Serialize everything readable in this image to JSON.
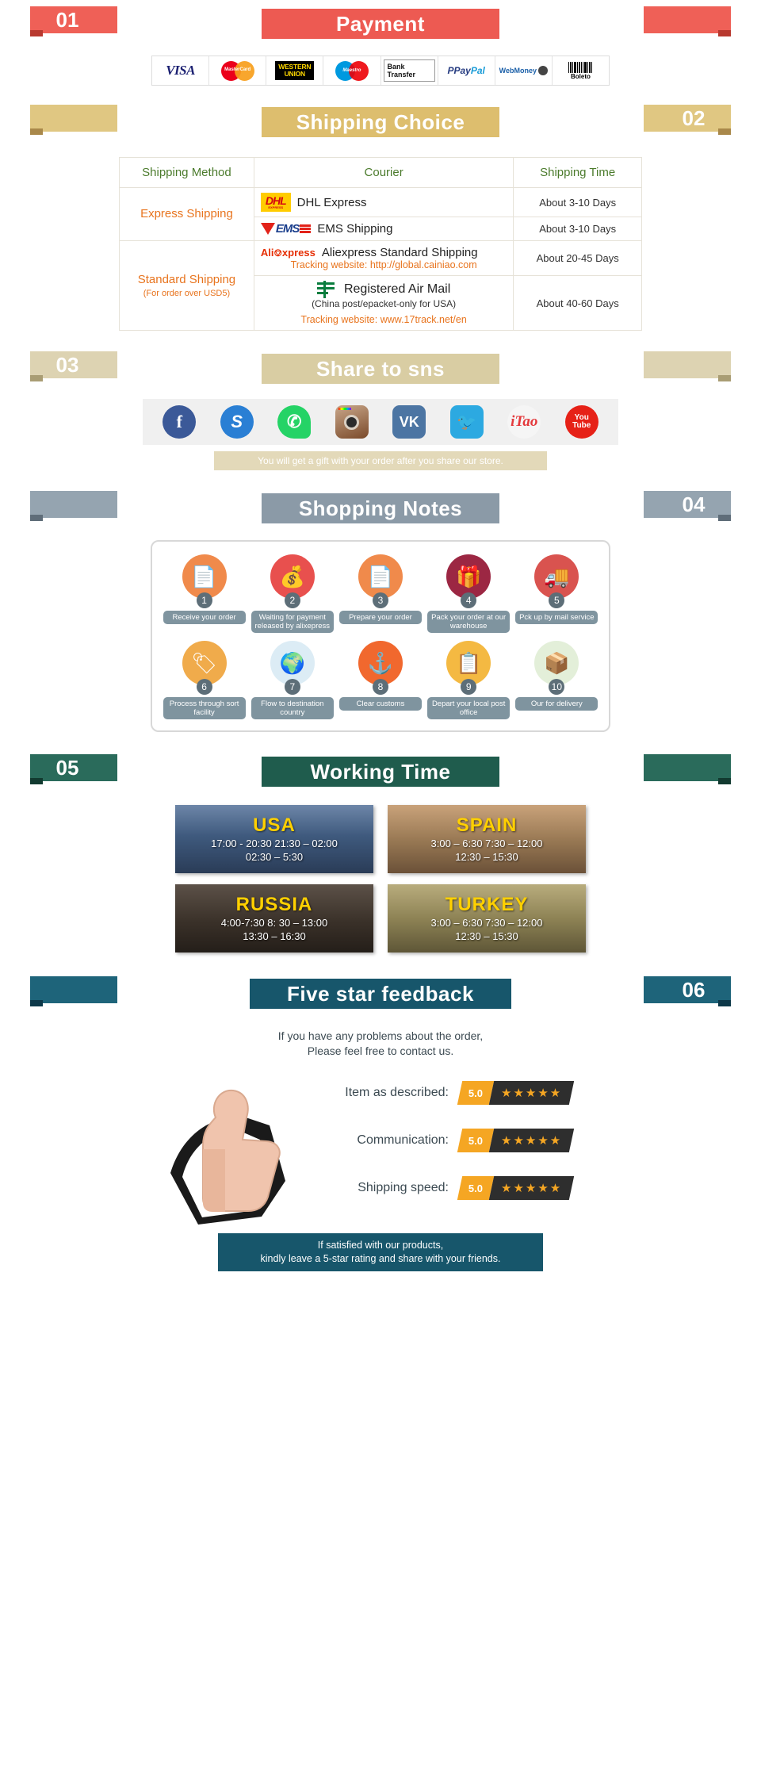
{
  "sections": {
    "payment": {
      "number": "01",
      "title": "Payment"
    },
    "shipping": {
      "number": "02",
      "title": "Shipping Choice"
    },
    "share": {
      "number": "03",
      "title": "Share to sns"
    },
    "notes": {
      "number": "04",
      "title": "Shopping Notes"
    },
    "working": {
      "number": "05",
      "title": "Working Time"
    },
    "feedback": {
      "number": "06",
      "title": "Five star feedback"
    }
  },
  "payment_methods": [
    {
      "name": "visa-logo",
      "label": "VISA"
    },
    {
      "name": "mastercard-logo",
      "label": "MasterCard"
    },
    {
      "name": "western-union-logo",
      "label": "WESTERN UNION"
    },
    {
      "name": "maestro-logo",
      "label": "Maestro"
    },
    {
      "name": "bank-transfer-logo",
      "label": "Bank Transfer"
    },
    {
      "name": "paypal-logo",
      "label": "PayPal"
    },
    {
      "name": "webmoney-logo",
      "label": "WebMoney"
    },
    {
      "name": "boleto-logo",
      "label": "Boleto"
    }
  ],
  "shipping_table": {
    "headers": [
      "Shipping Method",
      "Courier",
      "Shipping Time"
    ],
    "rows": [
      {
        "method": "Express Shipping",
        "method_sub": "",
        "couriers": [
          {
            "logo": "dhl-logo",
            "name": "DHL Express",
            "time": "About 3-10 Days",
            "tracking": ""
          },
          {
            "logo": "ems-logo",
            "name": "EMS Shipping",
            "time": "About 3-10 Days",
            "tracking": ""
          }
        ]
      },
      {
        "method": "Standard Shipping",
        "method_sub": "(For order over USD5)",
        "couriers": [
          {
            "logo": "aliexpress-logo",
            "name": "Aliexpress Standard Shipping",
            "time": "About 20-45 Days",
            "tracking": "Tracking website: http://global.cainiao.com"
          },
          {
            "logo": "china-post-logo",
            "name": "Registered Air Mail",
            "name_sub": "(China post/epacket-only for USA)",
            "time": "About 40-60 Days",
            "tracking": "Tracking website: www.17track.net/en"
          }
        ]
      }
    ]
  },
  "social": {
    "icons": [
      {
        "name": "facebook-icon",
        "glyph": "f"
      },
      {
        "name": "skype-icon",
        "glyph": "S"
      },
      {
        "name": "whatsapp-icon",
        "glyph": "✆"
      },
      {
        "name": "instagram-icon",
        "glyph": ""
      },
      {
        "name": "vk-icon",
        "glyph": "VK"
      },
      {
        "name": "twitter-icon",
        "glyph": "🐦"
      },
      {
        "name": "itao-icon",
        "glyph": "iTao"
      },
      {
        "name": "youtube-icon",
        "glyph": "You Tube"
      }
    ],
    "gift_note": "You will get a gift with your order after you share our store."
  },
  "shopping_notes": [
    {
      "num": "1",
      "label": "Receive\nyour order",
      "icon": "invoice-icon",
      "color": "#f08a4b"
    },
    {
      "num": "2",
      "label": "Waiting for payment\nreleased by alixepress",
      "icon": "money-bag-icon",
      "color": "#e8504e"
    },
    {
      "num": "3",
      "label": "Prepare\nyour order",
      "icon": "invoice-icon",
      "color": "#f08a4b"
    },
    {
      "num": "4",
      "label": "Pack your order\nat our warehouse",
      "icon": "gift-box-icon",
      "color": "#9c2743"
    },
    {
      "num": "5",
      "label": "Pck up by\nmail service",
      "icon": "mail-truck-icon",
      "color": "#d9534f"
    },
    {
      "num": "6",
      "label": "Process through\nsort facility",
      "icon": "sort-facility-icon",
      "color": "#f0ab4b"
    },
    {
      "num": "7",
      "label": "Flow to destination\ncountry",
      "icon": "globe-icon",
      "color": "#dcecf5"
    },
    {
      "num": "8",
      "label": "Clear\ncustoms",
      "icon": "anchor-icon",
      "color": "#f1682e"
    },
    {
      "num": "9",
      "label": "Depart your\nlocal post office",
      "icon": "clipboard-icon",
      "color": "#f4b942"
    },
    {
      "num": "10",
      "label": "Our for\ndelivery",
      "icon": "package-icon",
      "color": "#e3efd9"
    }
  ],
  "working_time": [
    {
      "city": "USA",
      "class": "usa",
      "hours": "17:00  -  20:30   21:30  –  02:00\n02:30  –  5:30"
    },
    {
      "city": "SPAIN",
      "class": "spain",
      "hours": "3:00  –  6:30   7:30  –  12:00\n12:30  –  15:30"
    },
    {
      "city": "RUSSIA",
      "class": "russia",
      "hours": "4:00-7:30    8: 30  –  13:00\n13:30  –  16:30"
    },
    {
      "city": "TURKEY",
      "class": "turkey",
      "hours": "3:00  –  6:30   7:30  –  12:00\n12:30  –  15:30"
    }
  ],
  "feedback": {
    "intro_line1": "If you have any problems about the order,",
    "intro_line2": "Please feel free to contact us.",
    "ratings": [
      {
        "label": "Item as described:",
        "score": "5.0",
        "stars": "★★★★★"
      },
      {
        "label": "Communication:",
        "score": "5.0",
        "stars": "★★★★★"
      },
      {
        "label": "Shipping speed:",
        "score": "5.0",
        "stars": "★★★★★"
      }
    ],
    "final_line1": "If satisfied with our products,",
    "final_line2": "kindly leave a 5-star rating and share with your friends."
  },
  "colors": {
    "payment_banner": "#ed5a52",
    "shipping_banner": "#ddbe6e",
    "share_banner": "#d9cda3",
    "notes_banner": "#8b9aa7",
    "working_banner": "#1f5c4d",
    "feedback_banner": "#17566b",
    "orange_text": "#e8741e",
    "green_text": "#4b7b2c",
    "star_gold": "#f5a623"
  }
}
